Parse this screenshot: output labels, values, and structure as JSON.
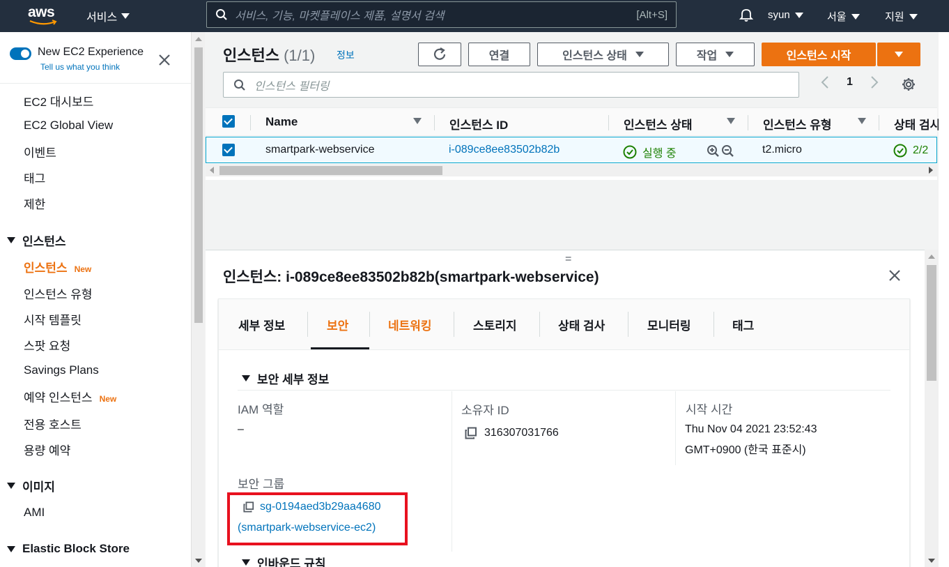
{
  "topnav": {
    "logo_text": "aws",
    "services_label": "서비스",
    "search_placeholder": "서비스, 기능, 마켓플레이스 제품, 설명서 검색",
    "search_shortcut": "[Alt+S]",
    "user_label": "syun",
    "region_label": "서울",
    "support_label": "지원",
    "icons": [
      "search-icon",
      "bell-icon"
    ]
  },
  "sidebar": {
    "toggle_label": "New EC2 Experience",
    "toggle_sub": "Tell us what you think",
    "items": [
      {
        "label": "EC2 대시보드"
      },
      {
        "label": "EC2 Global View"
      },
      {
        "label": "이벤트"
      },
      {
        "label": "태그"
      },
      {
        "label": "제한"
      }
    ],
    "section_instances": "인스턴스",
    "instances_items": [
      {
        "label": "인스턴스",
        "badge": "New",
        "active": true
      },
      {
        "label": "인스턴스 유형"
      },
      {
        "label": "시작 템플릿"
      },
      {
        "label": "스팟 요청"
      },
      {
        "label": "Savings Plans"
      },
      {
        "label": "예약 인스턴스",
        "badge": "New"
      },
      {
        "label": "전용 호스트"
      },
      {
        "label": "용량 예약"
      }
    ],
    "section_images": "이미지",
    "images_items": [
      {
        "label": "AMI"
      }
    ],
    "section_ebs": "Elastic Block Store"
  },
  "main": {
    "title": "인스턴스",
    "count": "(1/1)",
    "info_link": "정보",
    "buttons": {
      "connect": "연결",
      "instance_state": "인스턴스 상태",
      "actions": "작업",
      "launch": "인스턴스 시작"
    },
    "filter_placeholder": "인스턴스 필터링",
    "page_number": "1",
    "table": {
      "columns": [
        "Name",
        "인스턴스 ID",
        "인스턴스 상태",
        "인스턴스 유형",
        "상태 검사"
      ],
      "rows": [
        {
          "name": "smartpark-webservice",
          "instance_id": "i-089ce8ee83502b82b",
          "state": "실행 중",
          "type": "t2.micro",
          "status_check": "2/2"
        }
      ]
    }
  },
  "details": {
    "drag_handle": "=",
    "title": "인스턴스: i-089ce8ee83502b82b(smartpark-webservice)",
    "tabs": [
      "세부 정보",
      "보안",
      "네트워킹",
      "스토리지",
      "상태 검사",
      "모니터링",
      "태그"
    ],
    "active_tab": "보안",
    "section_title": "보안 세부 정보",
    "iam_label": "IAM 역할",
    "iam_value": "–",
    "owner_label": "소유자 ID",
    "owner_value": "316307031766",
    "launch_time_label": "시작 시간",
    "launch_time_line1": "Thu Nov 04 2021 23:52:43",
    "launch_time_line2": "GMT+0900 (한국 표준시)",
    "sg_label": "보안 그룹",
    "sg_id": "sg-0194aed3b29aa4680",
    "sg_name": "(smartpark-webservice-ec2)",
    "inbound_title": "인바운드 규칙"
  },
  "colors": {
    "nav_bg": "#232f3e",
    "accent_orange": "#ec7211",
    "link_blue": "#0073bb",
    "success_green": "#1d8102",
    "highlight_red": "#e8111f"
  }
}
